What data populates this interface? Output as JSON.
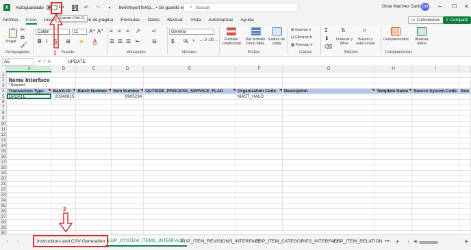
{
  "titlebar": {
    "autosave_label": "Autoguardado",
    "autosave_state": "No",
    "doc_title": "ItemImportTemp... • Se guardó en Esta PC",
    "search_placeholder": "Buscar",
    "user_name": "Omar Martínez Cambrón",
    "user_initials": "OM",
    "save_tooltip": "Guardar (Ctrl+G)"
  },
  "menu": {
    "items": [
      "Archivo",
      "Inicio",
      "Insertar",
      "Disposición de página",
      "Fórmulas",
      "Datos",
      "Revisar",
      "Vista",
      "Automatizar",
      "Ayuda"
    ],
    "comments_label": "Comentarios",
    "share_label": "Compartir"
  },
  "ribbon": {
    "paste_label": "Pegar",
    "font_name": "Calibri",
    "font_size": "11",
    "number_format": "General",
    "conditional_format": "Formato condicional",
    "format_as_table": "Dar formato como tabla",
    "cell_styles": "Estilos de celda",
    "insert": "Insertar",
    "delete": "Eliminar",
    "format": "Formato",
    "sort_filter": "Ordenar y filtrar",
    "find_select": "Buscar y seleccionar",
    "addins": "Complementos",
    "analyze": "Analizar datos",
    "groups": [
      "Portapapeles",
      "Fuente",
      "Alineación",
      "Número",
      "Estilos",
      "Celdas",
      "Edición",
      "Complementos"
    ],
    "currency_symbol": "$",
    "percent_symbol": "%"
  },
  "formula_bar": {
    "name_box": "A5",
    "fx": "fx",
    "value": "UPDATE"
  },
  "grid": {
    "columns": [
      "A",
      "B",
      "C",
      "D",
      "E",
      "F",
      "G",
      "H",
      "I"
    ],
    "rows": [
      "1",
      "2",
      "3",
      "4",
      "5",
      "6",
      "7",
      "8",
      "9",
      "10",
      "11",
      "12",
      "13",
      "14",
      "15",
      "16",
      "17",
      "18",
      "19",
      "20",
      "21",
      "22",
      "23",
      "24",
      "25",
      "26",
      "27",
      "28",
      "29",
      "30"
    ],
    "title": "Items Interface",
    "required_note": "* Required",
    "headers": [
      "Transaction Type",
      "Batch ID",
      "Batch Number",
      "Item Number",
      "OUTSIDE_PROCESS_SERVICE_FLAG",
      "Organization Code",
      "Description",
      "Template Name",
      "Source System Code",
      "Sou"
    ],
    "row5": [
      "UPDATE",
      "20240815",
      "",
      "9905234",
      "",
      "MAST_HALO",
      "",
      "",
      "",
      ""
    ]
  },
  "sheets": {
    "tabs": [
      "Instructions and CSV Generation",
      "EGP_SYSTEM_ITEMS_INTERFACE",
      "EGP_ITEM_REVISIONS_INTERFACE",
      "EGP_ITEM_CATEGORIES_INTERFACE",
      "EGP_ITEM_RELATIONSHIPS"
    ],
    "active_index": 1,
    "more": "•••"
  },
  "annotations": {
    "marker_1": "1",
    "marker_2": "2",
    "color": "#d32f2f"
  },
  "colors": {
    "accent": "#107c41",
    "header_fill": "#b4c7e7"
  }
}
